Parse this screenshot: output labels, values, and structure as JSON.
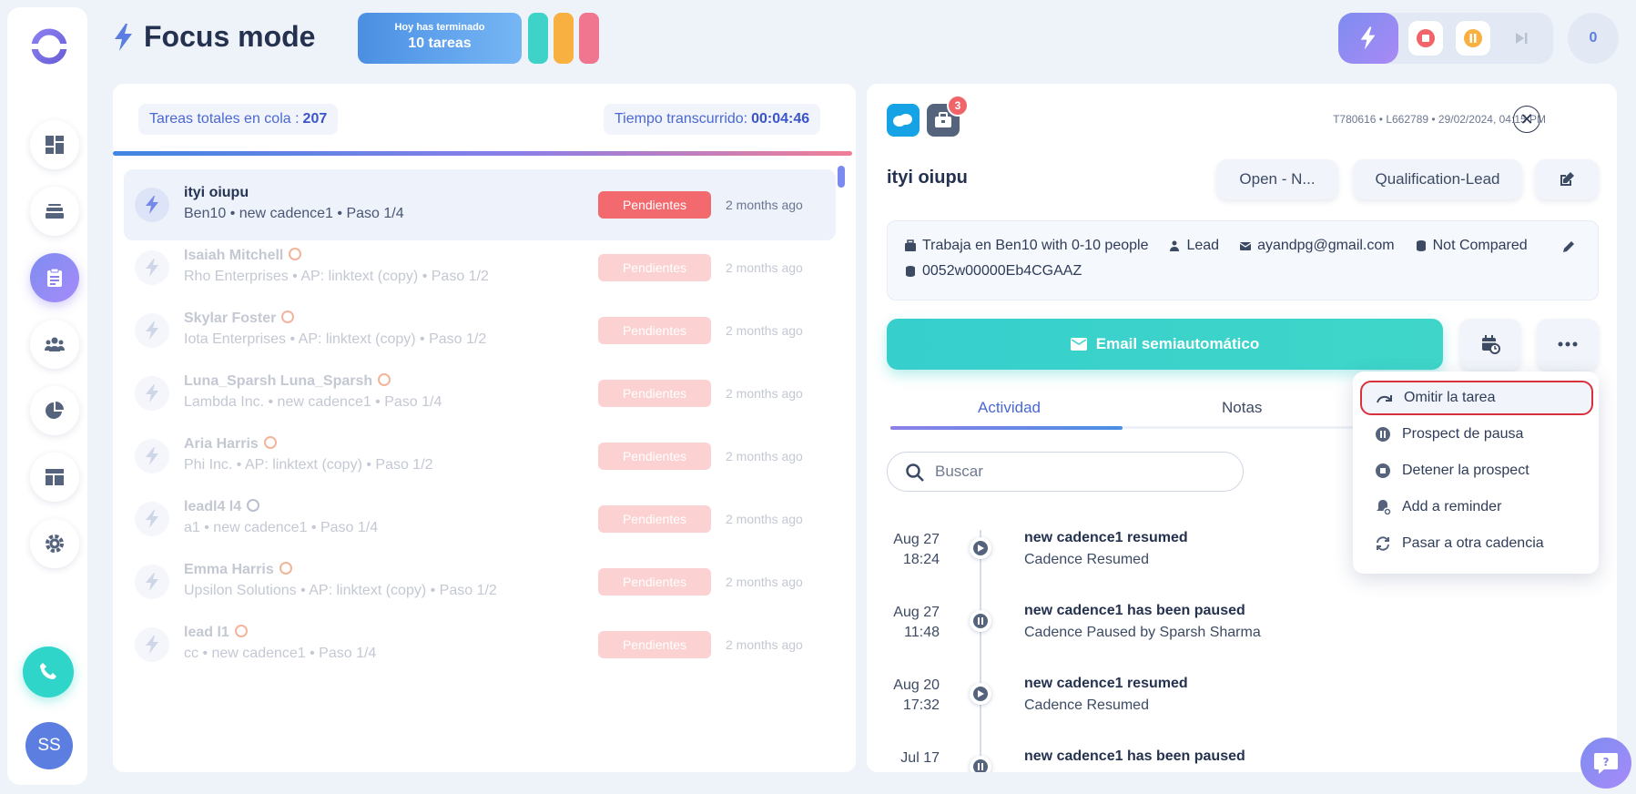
{
  "header": {
    "title": "Focus mode",
    "done_card": {
      "line1": "Hoy has terminado",
      "line2": "10 tareas"
    },
    "counter": "0"
  },
  "sidebar": {
    "items": [
      {
        "name": "dashboard"
      },
      {
        "name": "inbox"
      },
      {
        "name": "tasks",
        "active": true
      },
      {
        "name": "people"
      },
      {
        "name": "reports"
      },
      {
        "name": "templates"
      },
      {
        "name": "settings"
      }
    ],
    "avatar_initials": "SS"
  },
  "queue": {
    "total_label": "Tareas totales en cola :",
    "total_value": "207",
    "elapsed_label": "Tiempo transcurrido:",
    "elapsed_value": "00:04:46",
    "tasks": [
      {
        "name": "ityi oiupu",
        "sub": "Ben10 • new cadence1 • Paso 1/4",
        "status": "Pendientes",
        "time": "2 months ago"
      },
      {
        "name": "Isaiah Mitchell",
        "sub": "Rho Enterprises • AP: linktext (copy) • Paso 1/2",
        "status": "Pendientes",
        "time": "2 months ago"
      },
      {
        "name": "Skylar Foster",
        "sub": "Iota Enterprises • AP: linktext (copy) • Paso 1/2",
        "status": "Pendientes",
        "time": "2 months ago"
      },
      {
        "name": "Luna_Sparsh Luna_Sparsh",
        "sub": "Lambda Inc. • new cadence1 • Paso 1/4",
        "status": "Pendientes",
        "time": "2 months ago"
      },
      {
        "name": "Aria Harris",
        "sub": "Phi Inc. • AP: linktext (copy) • Paso 1/2",
        "status": "Pendientes",
        "time": "2 months ago"
      },
      {
        "name": "leadl4 l4",
        "sub": "a1 • new cadence1 • Paso 1/4",
        "status": "Pendientes",
        "time": "2 months ago"
      },
      {
        "name": "Emma Harris",
        "sub": "Upsilon Solutions • AP: linktext (copy) • Paso 1/2",
        "status": "Pendientes",
        "time": "2 months ago"
      },
      {
        "name": "lead l1",
        "sub": "cc • new cadence1 • Paso 1/4",
        "status": "Pendientes",
        "time": "2 months ago"
      }
    ]
  },
  "detail": {
    "notification_count": "3",
    "meta": "T780616 • L662789 • 29/02/2024, 04:15 PM",
    "lead_name": "ityi oiupu",
    "status_button": "Open - N...",
    "stage_button": "Qualification-Lead",
    "info": {
      "company": "Trabaja en Ben10 with 0-10 people",
      "type": "Lead",
      "email": "ayandpg@gmail.com",
      "compare": "Not Compared",
      "id": "0052w00000Eb4CGAAZ"
    },
    "email_button": "Email semiautomático",
    "tabs": [
      "Actividad",
      "Notas"
    ],
    "search_placeholder": "Buscar",
    "activities": [
      {
        "date": "Aug 27",
        "time": "18:24",
        "title": "new cadence1 resumed",
        "desc": "Cadence Resumed",
        "kind": "play"
      },
      {
        "date": "Aug 27",
        "time": "11:48",
        "title": "new cadence1 has been paused",
        "desc": "Cadence Paused by Sparsh Sharma",
        "kind": "pause"
      },
      {
        "date": "Aug 20",
        "time": "17:32",
        "title": "new cadence1 resumed",
        "desc": "Cadence Resumed",
        "kind": "play"
      },
      {
        "date": "Jul 17",
        "time": "",
        "title": "new cadence1 has been paused",
        "desc": "",
        "kind": "pause"
      }
    ]
  },
  "menu": {
    "items": [
      {
        "label": "Omitir la tarea",
        "icon": "skip-icon"
      },
      {
        "label": "Prospect de pausa",
        "icon": "pause-icon"
      },
      {
        "label": "Detener la prospect",
        "icon": "stop-icon"
      },
      {
        "label": "Add a reminder",
        "icon": "reminder-icon"
      },
      {
        "label": "Pasar a otra cadencia",
        "icon": "switch-icon"
      }
    ]
  },
  "colors": {
    "accent": "#4a68d4",
    "teal": "#3fd6c9",
    "danger": "#f26a6e",
    "highlight_border": "#d9303d"
  }
}
